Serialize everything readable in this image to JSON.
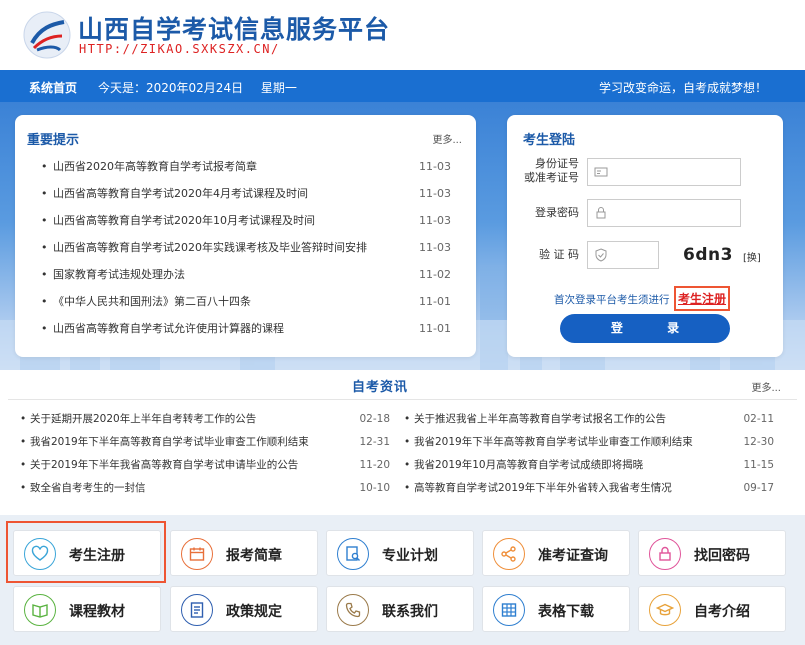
{
  "header": {
    "title": "山西自学考试信息服务平台",
    "url": "HTTP://ZIKAO.SXKSZX.CN/"
  },
  "nav": {
    "home": "系统首页",
    "date_label": "今天是：2020年02月24日",
    "weekday": "星期一",
    "slogan": "学习改变命运，自考成就梦想！"
  },
  "notice": {
    "title": "重要提示",
    "more": "更多...",
    "items": [
      {
        "text": "山西省2020年高等教育自学考试报考简章",
        "date": "11-03"
      },
      {
        "text": "山西省高等教育自学考试2020年4月考试课程及时间",
        "date": "11-03"
      },
      {
        "text": "山西省高等教育自学考试2020年10月考试课程及时间",
        "date": "11-03"
      },
      {
        "text": "山西省高等教育自学考试2020年实践课考核及毕业答辩时间安排",
        "date": "11-03"
      },
      {
        "text": "国家教育考试违规处理办法",
        "date": "11-02"
      },
      {
        "text": "《中华人民共和国刑法》第二百八十四条",
        "date": "11-01"
      },
      {
        "text": "山西省高等教育自学考试允许使用计算器的课程",
        "date": "11-01"
      }
    ]
  },
  "login": {
    "title": "考生登陆",
    "id_label_1": "身份证号",
    "id_label_2": "或准考证号",
    "password_label": "登录密码",
    "captcha_label": "验 证 码",
    "captcha_text": "6dn3",
    "captcha_refresh": "[换]",
    "register_prompt": "首次登录平台考生须进行",
    "register_link": "考生注册",
    "login_button": "登 录"
  },
  "news": {
    "title": "自考资讯",
    "more": "更多...",
    "left": [
      {
        "text": "关于延期开展2020年上半年自考转考工作的公告",
        "date": "02-18"
      },
      {
        "text": "我省2019年下半年高等教育自学考试毕业审查工作顺利结束",
        "date": "12-31"
      },
      {
        "text": "关于2019年下半年我省高等教育自学考试申请毕业的公告",
        "date": "11-20"
      },
      {
        "text": "致全省自考考生的一封信",
        "date": "10-10"
      }
    ],
    "right": [
      {
        "text": "关于推迟我省上半年高等教育自学考试报名工作的公告",
        "date": "02-11"
      },
      {
        "text": "我省2019年下半年高等教育自学考试毕业审查工作顺利结束",
        "date": "12-30"
      },
      {
        "text": "我省2019年10月高等教育自学考试成绩即将揭晓",
        "date": "11-15"
      },
      {
        "text": "高等教育自学考试2019年下半年外省转入我省考生情况",
        "date": "09-17"
      }
    ]
  },
  "quick": {
    "register": "考生注册",
    "guide": "报考简章",
    "plan": "专业计划",
    "admission": "准考证查询",
    "password": "找回密码",
    "textbooks": "课程教材",
    "policy": "政策规定",
    "contact": "联系我们",
    "forms": "表格下载",
    "intro": "自考介绍"
  },
  "colors": {
    "brand_blue": "#1a6fd1",
    "highlight_red": "#e53333"
  }
}
